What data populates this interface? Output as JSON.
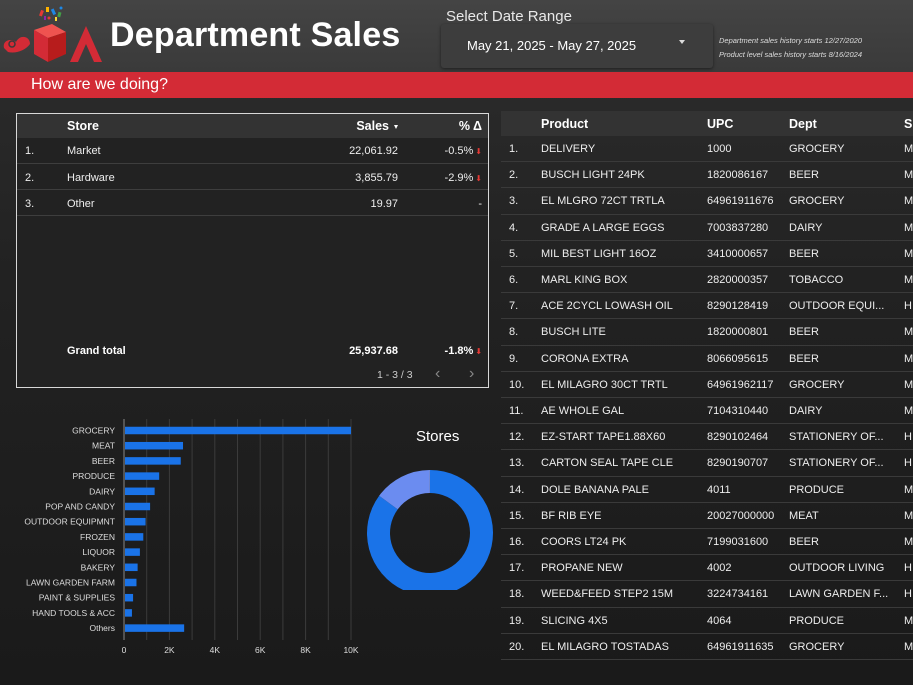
{
  "header": {
    "title": "Department Sales",
    "date_label": "Select Date Range",
    "date_range": "May 21, 2025 - May 27, 2025",
    "note_1": "Department sales history starts 12/27/2020",
    "note_2": "Product level sales history starts 8/16/2024",
    "banner": "How are we doing?"
  },
  "colors": {
    "banner_red": "#d32b36",
    "bar_blue": "#1a73e8",
    "donut_light": "#6b8cf0",
    "down_red": "#e53935"
  },
  "store_table": {
    "columns": [
      "Store",
      "Sales",
      "% Δ"
    ],
    "rows": [
      {
        "idx": "1.",
        "store": "Market",
        "sales": "22,061.92",
        "pct": "-0.5%"
      },
      {
        "idx": "2.",
        "store": "Hardware",
        "sales": "3,855.79",
        "pct": "-2.9%"
      },
      {
        "idx": "3.",
        "store": "Other",
        "sales": "19.97",
        "pct": "-"
      }
    ],
    "total": {
      "label": "Grand total",
      "sales": "25,937.68",
      "pct": "-1.8%"
    },
    "pager": "1 - 3 / 3",
    "prev_icon": "chevron-left-icon",
    "next_icon": "chevron-right-icon"
  },
  "product_table": {
    "columns": [
      "Product",
      "UPC",
      "Dept",
      "S"
    ],
    "rows": [
      {
        "idx": "1.",
        "product": "DELIVERY",
        "upc": "1000",
        "dept": "GROCERY",
        "s": "M"
      },
      {
        "idx": "2.",
        "product": "BUSCH LIGHT 24PK",
        "upc": "1820086167",
        "dept": "BEER",
        "s": "M"
      },
      {
        "idx": "3.",
        "product": "EL MLGRO 72CT TRTLA",
        "upc": "64961911676",
        "dept": "GROCERY",
        "s": "M"
      },
      {
        "idx": "4.",
        "product": "GRADE A LARGE EGGS",
        "upc": "7003837280",
        "dept": "DAIRY",
        "s": "M"
      },
      {
        "idx": "5.",
        "product": "MIL BEST LIGHT 16OZ",
        "upc": "3410000657",
        "dept": "BEER",
        "s": "M"
      },
      {
        "idx": "6.",
        "product": "MARL KING BOX",
        "upc": "2820000357",
        "dept": "TOBACCO",
        "s": "M"
      },
      {
        "idx": "7.",
        "product": "ACE 2CYCL LOWASH OIL",
        "upc": "8290128419",
        "dept": "OUTDOOR EQUI...",
        "s": "H"
      },
      {
        "idx": "8.",
        "product": "BUSCH LITE",
        "upc": "1820000801",
        "dept": "BEER",
        "s": "M"
      },
      {
        "idx": "9.",
        "product": "CORONA EXTRA",
        "upc": "8066095615",
        "dept": "BEER",
        "s": "M"
      },
      {
        "idx": "10.",
        "product": "EL MILAGRO 30CT TRTL",
        "upc": "64961962117",
        "dept": "GROCERY",
        "s": "M"
      },
      {
        "idx": "11.",
        "product": "AE WHOLE GAL",
        "upc": "7104310440",
        "dept": "DAIRY",
        "s": "M"
      },
      {
        "idx": "12.",
        "product": "EZ-START TAPE1.88X60",
        "upc": "8290102464",
        "dept": "STATIONERY OF...",
        "s": "H"
      },
      {
        "idx": "13.",
        "product": "CARTON SEAL TAPE CLE",
        "upc": "8290190707",
        "dept": "STATIONERY OF...",
        "s": "H"
      },
      {
        "idx": "14.",
        "product": "DOLE BANANA PALE",
        "upc": "4011",
        "dept": "PRODUCE",
        "s": "M"
      },
      {
        "idx": "15.",
        "product": "BF RIB EYE",
        "upc": "20027000000",
        "dept": "MEAT",
        "s": "M"
      },
      {
        "idx": "16.",
        "product": "COORS LT24 PK",
        "upc": "7199031600",
        "dept": "BEER",
        "s": "M"
      },
      {
        "idx": "17.",
        "product": "PROPANE NEW",
        "upc": "4002",
        "dept": "OUTDOOR LIVING",
        "s": "H"
      },
      {
        "idx": "18.",
        "product": "WEED&FEED STEP2 15M",
        "upc": "3224734161",
        "dept": "LAWN GARDEN F...",
        "s": "H"
      },
      {
        "idx": "19.",
        "product": "SLICING 4X5",
        "upc": "4064",
        "dept": "PRODUCE",
        "s": "M"
      },
      {
        "idx": "20.",
        "product": "EL MILAGRO TOSTADAS",
        "upc": "64961911635",
        "dept": "GROCERY",
        "s": "M"
      }
    ]
  },
  "chart_data": [
    {
      "type": "bar",
      "orientation": "horizontal",
      "categories": [
        "GROCERY",
        "MEAT",
        "BEER",
        "PRODUCE",
        "DAIRY",
        "POP AND CANDY",
        "OUTDOOR EQUIPMNT",
        "FROZEN",
        "LIQUOR",
        "BAKERY",
        "LAWN GARDEN FARM",
        "PAINT & SUPPLIES",
        "HAND TOOLS & ACC",
        "Others"
      ],
      "values": [
        10000,
        2600,
        2500,
        1550,
        1350,
        1150,
        950,
        850,
        700,
        600,
        550,
        400,
        350,
        2650
      ],
      "xticks": [
        "0",
        "2K",
        "4K",
        "6K",
        "8K",
        "10K"
      ],
      "xlim": [
        0,
        10000
      ],
      "grid": true,
      "color": "#1a73e8"
    },
    {
      "type": "pie",
      "title": "Stores",
      "donut": true,
      "labels": [
        "Market",
        "Hardware",
        "Other"
      ],
      "values": [
        22061.92,
        3855.79,
        19.97
      ],
      "colors": [
        "#1a73e8",
        "#6b8cf0",
        "#9fb4f5"
      ]
    }
  ]
}
